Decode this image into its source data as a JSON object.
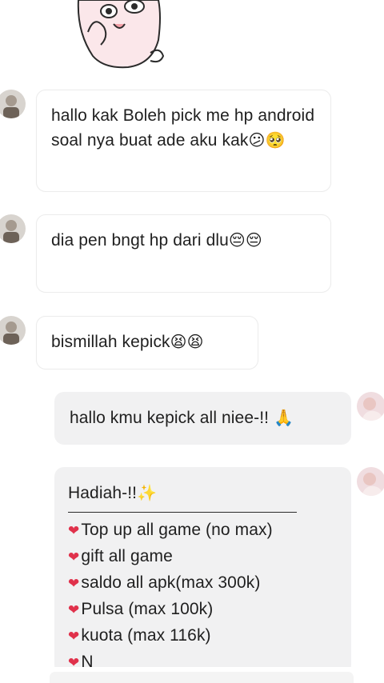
{
  "sticker": {
    "icon": "cat-sticker-icon"
  },
  "messages": [
    {
      "side": "in",
      "text": "hallo kak Boleh pick me hp android soal nya buat ade aku kak",
      "emoji": "😕🥺"
    },
    {
      "side": "in",
      "text": "dia pen bngt hp dari dlu",
      "emoji": "😔😔"
    },
    {
      "side": "in",
      "text": "bismillah kepick",
      "emoji": "😫😫"
    },
    {
      "side": "out",
      "text": "hallo kmu kepick all niee-!!",
      "emoji": "🙏"
    }
  ],
  "gift": {
    "title": "Hadiah-!!",
    "title_emoji": "✨",
    "heart_icon": "heart-icon",
    "items": [
      "Top up all game (no max)",
      "gift all game",
      "saldo all apk(max 300k)",
      "Pulsa (max 100k)",
      "kuota (max 116k)",
      "N"
    ]
  },
  "colors": {
    "incoming_bubble": "#ffffff",
    "outgoing_bubble": "#f1f1f2",
    "heart": "#e0314b"
  }
}
